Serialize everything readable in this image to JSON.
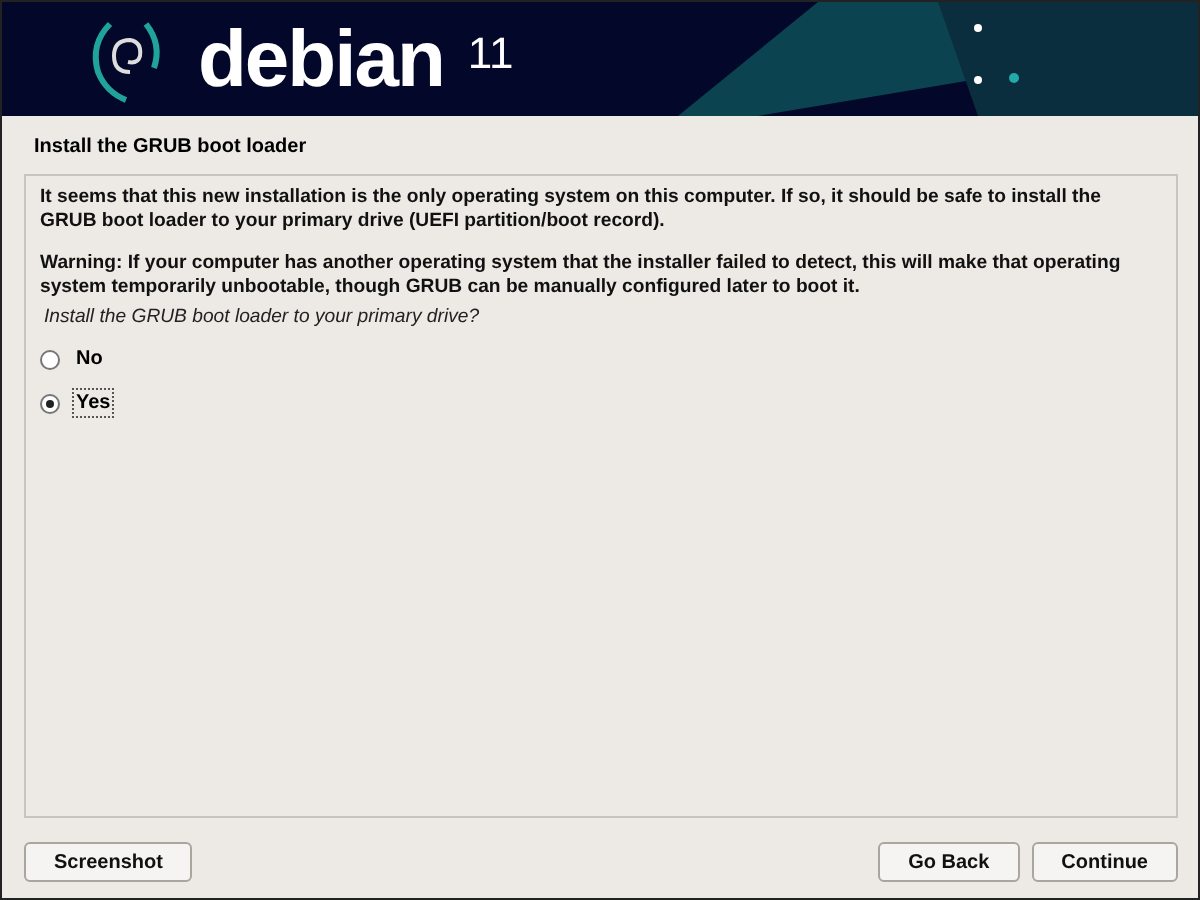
{
  "banner": {
    "logo_text": "debian",
    "version": "11"
  },
  "title": "Install the GRUB boot loader",
  "paragraphs": [
    "It seems that this new installation is the only operating system on this computer. If so, it should be safe to install the GRUB boot loader to your primary drive (UEFI partition/boot record).",
    "Warning: If your computer has another operating system that the installer failed to detect, this will make that operating system temporarily unbootable, though GRUB can be manually configured later to boot it."
  ],
  "question": "Install the GRUB boot loader to your primary drive?",
  "options": [
    {
      "label": "No",
      "selected": false
    },
    {
      "label": "Yes",
      "selected": true
    }
  ],
  "buttons": {
    "left": "Screenshot",
    "right": [
      "Go Back",
      "Continue"
    ]
  }
}
